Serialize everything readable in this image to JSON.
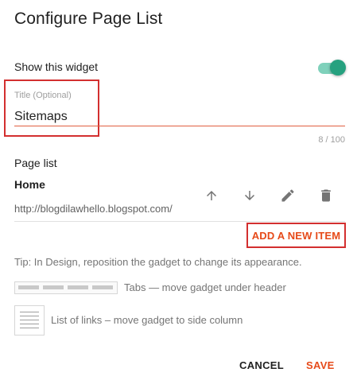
{
  "dialog": {
    "title": "Configure Page List"
  },
  "widget_toggle": {
    "label": "Show this widget",
    "state": "on"
  },
  "title_field": {
    "label": "Title (Optional)",
    "value": "Sitemaps",
    "counter": "8 / 100"
  },
  "page_list": {
    "label": "Page list",
    "items": [
      {
        "name": "Home",
        "url": "http://blogdilawhello.blogspot.com/",
        "actions": [
          "arrow-up-icon",
          "arrow-down-icon",
          "pencil-icon",
          "trash-icon"
        ]
      }
    ],
    "add_label": "ADD A NEW ITEM"
  },
  "tip": "Tip: In Design, reposition the gadget to change its appearance.",
  "layouts": {
    "tabs_label": "Tabs — move gadget under header",
    "list_label": "List of links – move gadget to side column"
  },
  "footer": {
    "cancel_label": "CANCEL",
    "save_label": "SAVE"
  },
  "colors": {
    "accent": "#e64a19",
    "toggle_thumb": "#26a17f",
    "toggle_track": "#7fd1bb",
    "highlight_box": "#d32f2f",
    "underline": "#e06040",
    "icon": "#757575",
    "text_primary": "#212121",
    "text_secondary": "#757575"
  }
}
